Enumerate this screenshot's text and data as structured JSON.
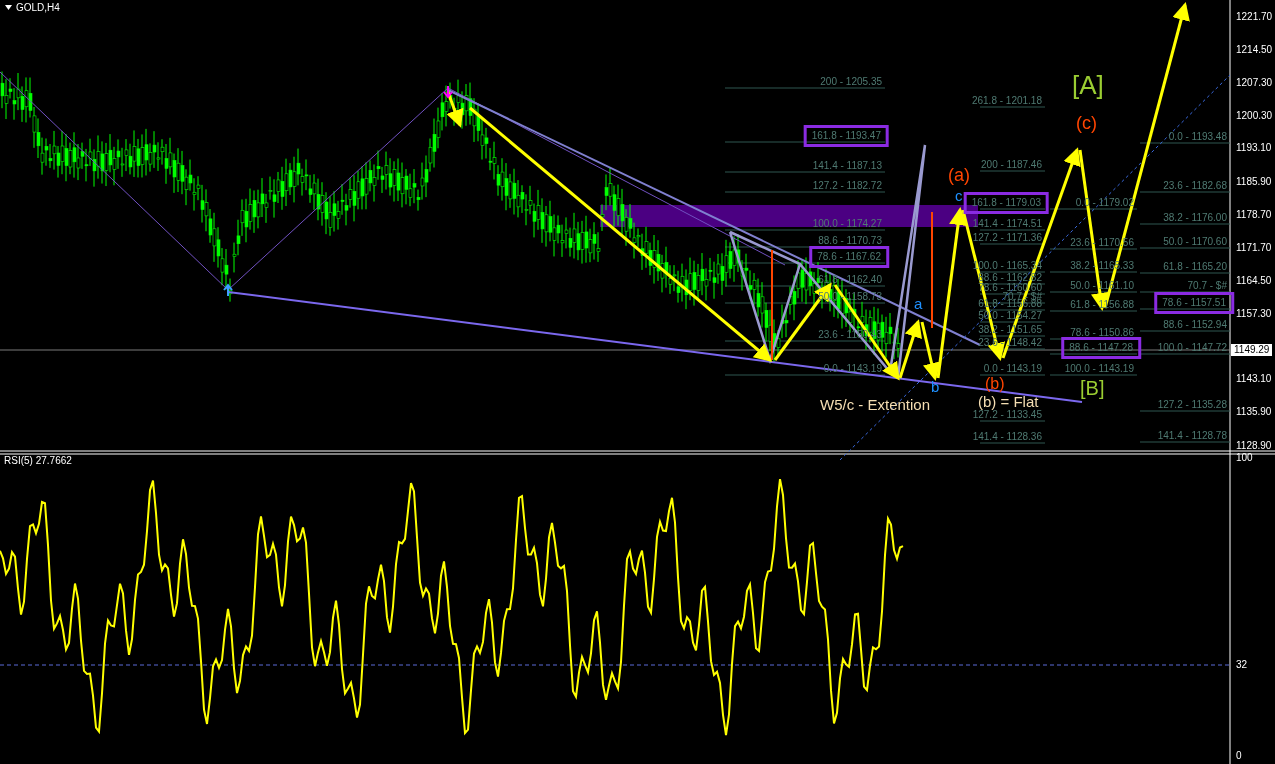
{
  "symbol": {
    "title": "GOLD,H4"
  },
  "fib_groups": [
    {
      "levels": [
        {
          "label": "200 - 1205.35",
          "boxed": false
        },
        {
          "label": "161.8 - 1193.47",
          "boxed": true
        },
        {
          "label": "141.4 - 1187.13",
          "boxed": false
        },
        {
          "label": "127.2 - 1182.72",
          "boxed": false
        },
        {
          "label": "100.0 - 1174.27",
          "boxed": false
        },
        {
          "label": "88.6 - 1170.73",
          "boxed": false
        },
        {
          "label": "78.6 - 1167.62",
          "boxed": true
        },
        {
          "label": "61.8 - 1162.40",
          "boxed": false
        },
        {
          "label": "50.0 - 1158.73",
          "boxed": false
        },
        {
          "label": "23.6 - 1150.43",
          "boxed": false
        },
        {
          "label": "0.0 - 1143.19",
          "boxed": false
        }
      ]
    },
    {
      "levels": [
        {
          "label": "261.8 - 1201.18",
          "boxed": false
        },
        {
          "label": "200 - 1187.46",
          "boxed": false
        },
        {
          "label": "161.8 - 1179.03",
          "boxed": true
        },
        {
          "label": "141.4 - 1174.51",
          "boxed": false
        },
        {
          "label": "127.2 - 1171.36",
          "boxed": false
        },
        {
          "label": "100.0 - 1165.34",
          "boxed": false
        },
        {
          "label": "88.6 - 1162.82",
          "boxed": false
        },
        {
          "label": "78.6 - 1160.60",
          "boxed": false
        },
        {
          "label": "70.7 - $#",
          "boxed": false
        },
        {
          "label": "61.8 - 1156.88",
          "boxed": false
        },
        {
          "label": "50.0 - 1154.27",
          "boxed": false
        },
        {
          "label": "38.2 - 1151.65",
          "boxed": false
        },
        {
          "label": "23.6 - 1148.42",
          "boxed": false
        },
        {
          "label": "0.0 - 1143.19",
          "boxed": false
        },
        {
          "label": "127.2 - 1133.45",
          "boxed": false
        },
        {
          "label": "141.4 - 1128.36",
          "boxed": false
        }
      ]
    },
    {
      "levels": [
        {
          "label": "0.0 - 1179.02",
          "boxed": false
        },
        {
          "label": "23.6 - 1170.56",
          "boxed": false
        },
        {
          "label": "38.2 - 1165.33",
          "boxed": false
        },
        {
          "label": "50.0 - 1161.10",
          "boxed": false
        },
        {
          "label": "61.8 - 1156.88",
          "boxed": false
        },
        {
          "label": "78.6 - 1150.86",
          "boxed": false
        },
        {
          "label": "88.6 - 1147.28",
          "boxed": true
        },
        {
          "label": "100.0 - 1143.19",
          "boxed": false
        }
      ]
    },
    {
      "levels": [
        {
          "label": "0.0 - 1193.48",
          "boxed": false
        },
        {
          "label": "23.6 - 1182.68",
          "boxed": false
        },
        {
          "label": "38.2 - 1176.00",
          "boxed": false
        },
        {
          "label": "50.0 - 1170.60",
          "boxed": false
        },
        {
          "label": "61.8 - 1165.20",
          "boxed": false
        },
        {
          "label": "70.7 - $#",
          "boxed": false
        },
        {
          "label": "78.6 - 1157.51",
          "boxed": true
        },
        {
          "label": "88.6 - 1152.94",
          "boxed": false
        },
        {
          "label": "100.0 - 1147.72",
          "boxed": false
        },
        {
          "label": "127.2 - 1135.28",
          "boxed": false
        },
        {
          "label": "141.4 - 1128.78",
          "boxed": false
        }
      ]
    }
  ],
  "wave_labels": [
    {
      "text": "[A]",
      "color": "#9acd32"
    },
    {
      "text": "(c)",
      "color": "#ff4500"
    },
    {
      "text": "(a)",
      "color": "#ff4500"
    },
    {
      "text": "c",
      "color": "#1e90ff"
    },
    {
      "text": "a",
      "color": "#1e90ff"
    },
    {
      "text": "b",
      "color": "#1e90ff"
    },
    {
      "text": "(b)",
      "color": "#ff4500"
    },
    {
      "text": "[B]",
      "color": "#9acd32"
    },
    {
      "text": "W5/c - Extention",
      "color": "#f5deb3"
    },
    {
      "text": "(b) = Flat",
      "color": "#f5deb3"
    }
  ],
  "price_axis": {
    "ticks": [
      "1221.70",
      "1214.50",
      "1207.30",
      "1200.30",
      "1193.10",
      "1185.90",
      "1178.70",
      "1171.70",
      "1164.50",
      "1157.30",
      "1143.10",
      "1135.90",
      "1128.90"
    ],
    "current_price": "1149.29"
  },
  "rsi": {
    "title": "RSI(5) 27.7662",
    "axis": [
      "100",
      "32",
      "0"
    ]
  }
}
